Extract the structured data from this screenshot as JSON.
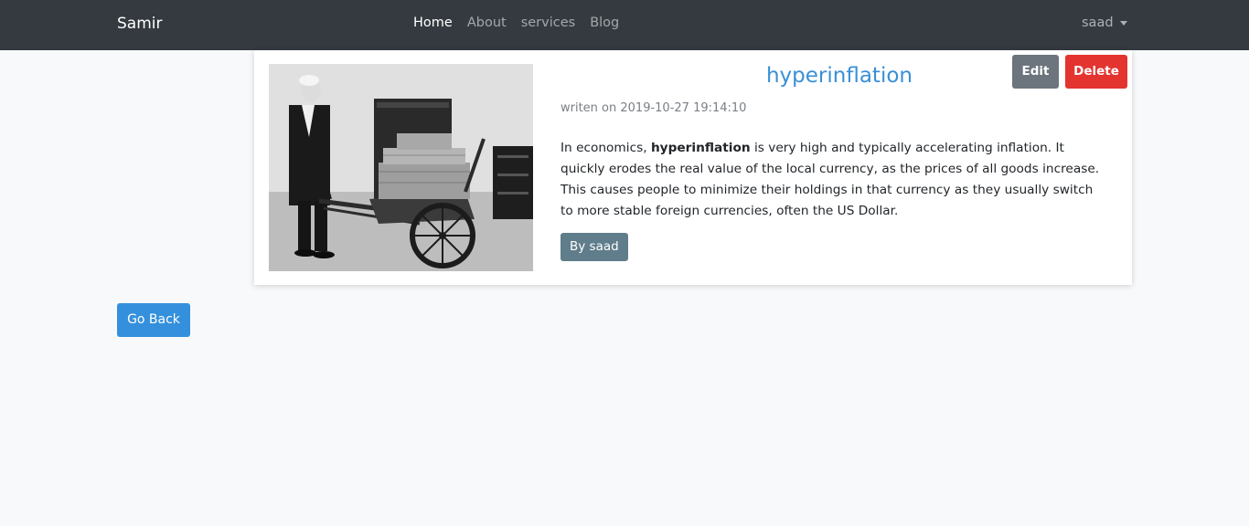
{
  "navbar": {
    "brand": "Samir",
    "links": [
      {
        "label": "Home",
        "active": true
      },
      {
        "label": "About",
        "active": false
      },
      {
        "label": "services",
        "active": false
      },
      {
        "label": "Blog",
        "active": false
      }
    ],
    "user": "saad"
  },
  "post": {
    "title": "hyperinflation",
    "date_line": "writen on 2019-10-27 19:14:10",
    "body_prefix": "In economics, ",
    "body_bold": "hyperinflation",
    "body_suffix": " is very high and typically accelerating inflation. It quickly erodes the real value of the local currency, as the prices of all goods increase. This causes people to minimize their holdings in that currency as they usually switch to more stable foreign currencies, often the US Dollar.",
    "author": "By saad",
    "image_icon": "photo-man-with-wheelbarrow-of-money"
  },
  "actions": {
    "edit_label": "Edit",
    "delete_label": "Delete",
    "back_label": "Go Back"
  },
  "colors": {
    "navbar_bg": "#343a40",
    "title": "#3a8fd6",
    "edit_bg": "#6c757d",
    "delete_bg": "#e3342f",
    "author_bg": "#607d8b",
    "back_bg": "#3490dc"
  }
}
